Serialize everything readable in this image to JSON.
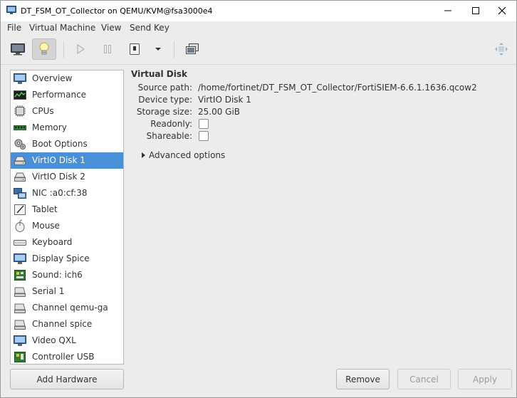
{
  "window": {
    "title": "DT_FSM_OT_Collector on QEMU/KVM@fsa3000e4",
    "controls": [
      "minimize",
      "maximize",
      "close"
    ]
  },
  "menubar": {
    "items": [
      "File",
      "Virtual Machine",
      "View",
      "Send Key"
    ]
  },
  "toolbar": {
    "buttons": [
      "monitor-icon",
      "lightbulb-icon",
      "play-icon",
      "pause-icon",
      "power-icon",
      "dropdown-arrow-icon",
      "screenshot-icon",
      "fullscreen-icon"
    ],
    "active": "lightbulb-icon"
  },
  "sidebar": {
    "items": [
      {
        "label": "Overview",
        "icon": "overview-icon"
      },
      {
        "label": "Performance",
        "icon": "performance-icon"
      },
      {
        "label": "CPUs",
        "icon": "cpu-icon"
      },
      {
        "label": "Memory",
        "icon": "memory-icon"
      },
      {
        "label": "Boot Options",
        "icon": "gear-icon"
      },
      {
        "label": "VirtIO Disk 1",
        "icon": "disk-icon"
      },
      {
        "label": "VirtIO Disk 2",
        "icon": "disk-icon"
      },
      {
        "label": "NIC :a0:cf:38",
        "icon": "network-icon"
      },
      {
        "label": "Tablet",
        "icon": "tablet-icon"
      },
      {
        "label": "Mouse",
        "icon": "mouse-icon"
      },
      {
        "label": "Keyboard",
        "icon": "keyboard-icon"
      },
      {
        "label": "Display Spice",
        "icon": "display-icon"
      },
      {
        "label": "Sound: ich6",
        "icon": "sound-icon"
      },
      {
        "label": "Serial 1",
        "icon": "serial-icon"
      },
      {
        "label": "Channel qemu-ga",
        "icon": "channel-icon"
      },
      {
        "label": "Channel spice",
        "icon": "channel-icon"
      },
      {
        "label": "Video QXL",
        "icon": "video-icon"
      },
      {
        "label": "Controller USB",
        "icon": "controller-icon"
      }
    ],
    "selected": "VirtIO Disk 1"
  },
  "details": {
    "title": "Virtual Disk",
    "source_path_label": "Source path:",
    "source_path": "/home/fortinet/DT_FSM_OT_Collector/FortiSIEM-6.6.1.1636.qcow2",
    "device_type_label": "Device type:",
    "device_type": "VirtIO Disk 1",
    "storage_size_label": "Storage size:",
    "storage_size": "25.00 GiB",
    "readonly_label": "Readonly:",
    "readonly": false,
    "shareable_label": "Shareable:",
    "shareable": false,
    "advanced_label": "Advanced options"
  },
  "footer": {
    "add_hardware": "Add Hardware",
    "remove": "Remove",
    "cancel": "Cancel",
    "apply": "Apply"
  },
  "colors": {
    "selection": "#4a90d9",
    "window_bg": "#ececec"
  }
}
